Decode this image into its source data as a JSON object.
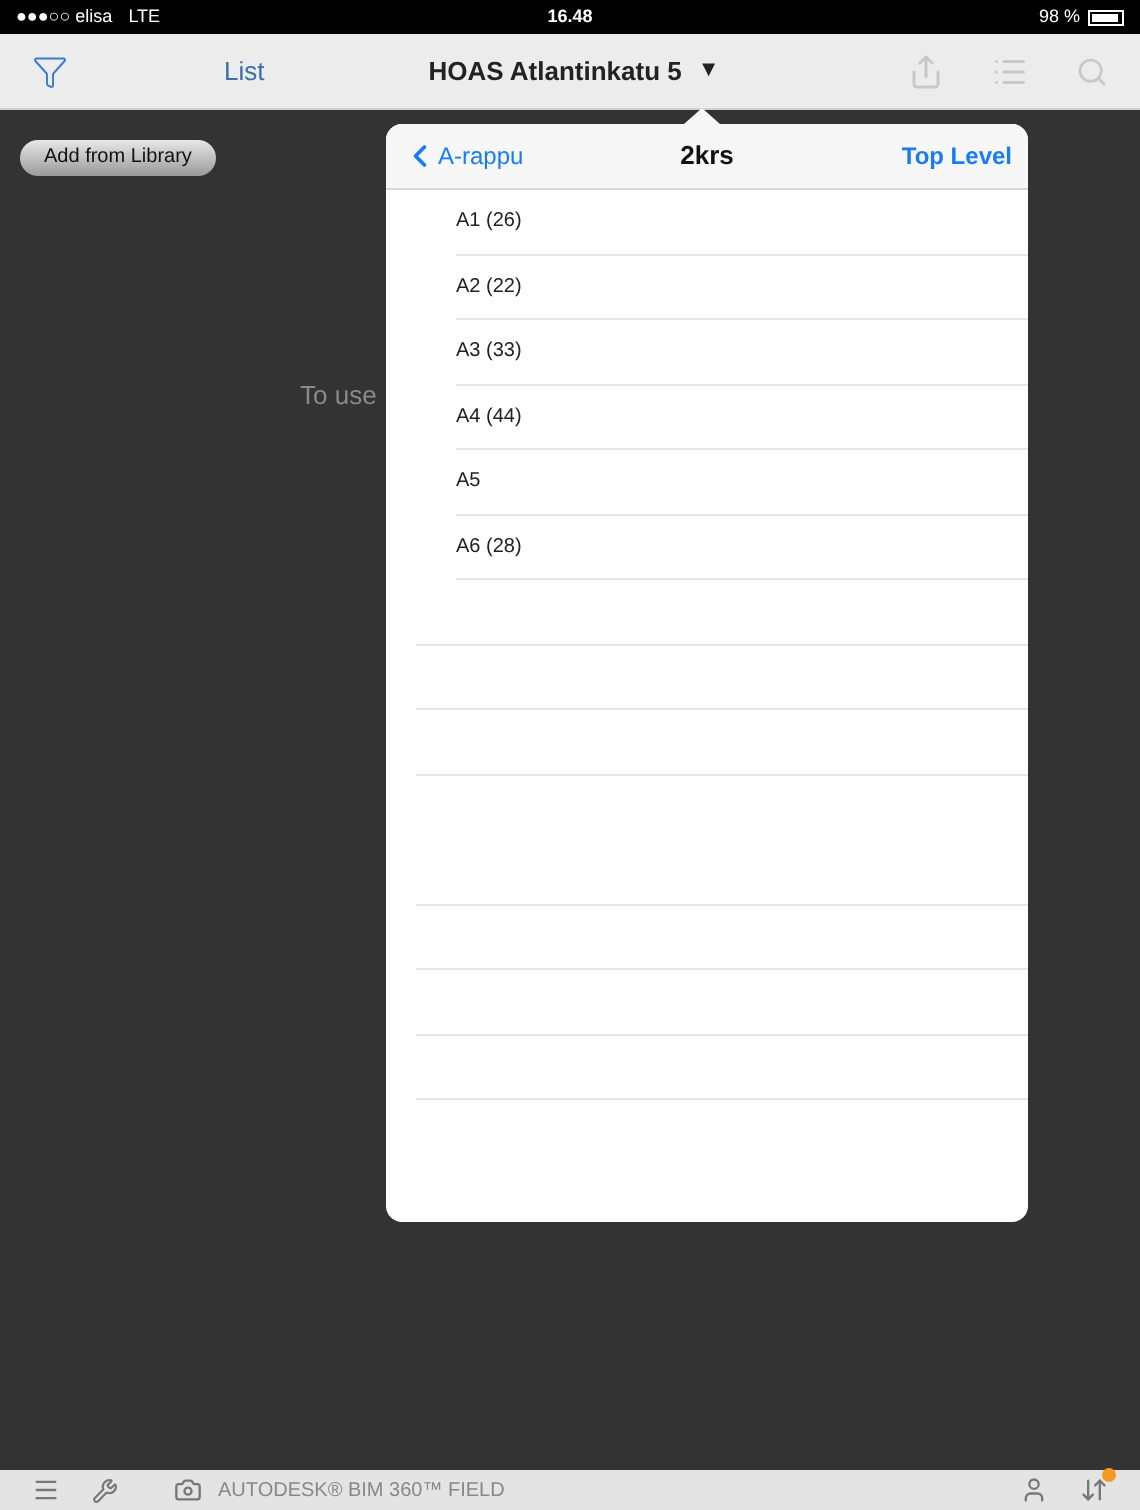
{
  "status_bar": {
    "carrier": "●●●○○ elisa",
    "network": "LTE",
    "time": "16.48",
    "battery": "98 %"
  },
  "nav_bar": {
    "list_label": "List",
    "title": "HOAS Atlantinkatu 5",
    "title_caret": "▼"
  },
  "toolbar": {
    "add_button": "Add from Library"
  },
  "background_message": "To use",
  "popover": {
    "back_label": "A-rappu",
    "title": "2krs",
    "top_level_label": "Top Level",
    "items": [
      {
        "label": "A1 (26)"
      },
      {
        "label": "A2 (22)"
      },
      {
        "label": "A3 (33)"
      },
      {
        "label": "A4 (44)"
      },
      {
        "label": "A5"
      },
      {
        "label": "A6 (28)"
      }
    ]
  },
  "bottom_bar": {
    "brand": "AUTODESK® BIM 360™ FIELD",
    "sync_badge": true
  }
}
